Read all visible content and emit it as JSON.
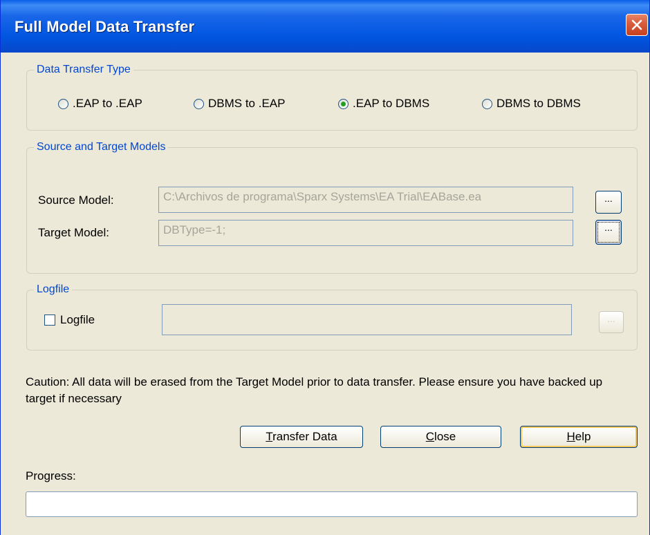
{
  "window": {
    "title": "Full Model Data Transfer"
  },
  "transfer_type": {
    "legend": "Data Transfer Type",
    "options": [
      {
        "label": ".EAP to .EAP",
        "selected": false
      },
      {
        "label": "DBMS to .EAP",
        "selected": false
      },
      {
        "label": ".EAP to DBMS",
        "selected": true
      },
      {
        "label": "DBMS to DBMS",
        "selected": false
      }
    ]
  },
  "models": {
    "legend": "Source and Target Models",
    "source_label": "Source Model:",
    "source_value": "C:\\Archivos de programa\\Sparx Systems\\EA Trial\\EABase.ea",
    "target_label": "Target Model:",
    "target_value": "DBType=-1;",
    "browse_label": "..."
  },
  "logfile": {
    "legend": "Logfile",
    "checkbox_label": "Logfile",
    "checked": false,
    "path_value": "",
    "browse_label": "..."
  },
  "caution_text": "Caution: All data will be erased from the Target Model prior to data transfer. Please ensure you have backed up target if necessary",
  "buttons": {
    "transfer_hotkey": "T",
    "transfer_rest": "ransfer Data",
    "close_hotkey": "C",
    "close_rest": "lose",
    "help_hotkey": "H",
    "help_rest": "elp"
  },
  "progress": {
    "label": "Progress:",
    "value": 0
  },
  "colors": {
    "accent": "#0046d5",
    "dialog_bg": "#ece9d8",
    "selected_dot": "#21a121"
  }
}
